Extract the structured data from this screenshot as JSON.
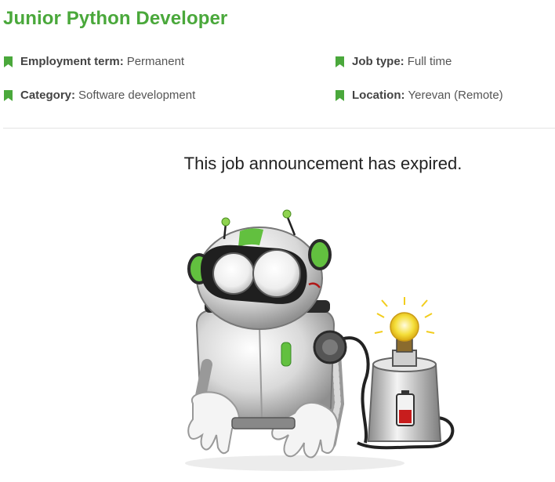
{
  "job": {
    "title": "Junior Python Developer"
  },
  "details": [
    {
      "label": "Employment term:",
      "value": "Permanent"
    },
    {
      "label": "Job type:",
      "value": "Full time"
    },
    {
      "label": "Category:",
      "value": "Software development"
    },
    {
      "label": "Location:",
      "value": "Yerevan (Remote)"
    }
  ],
  "notice": {
    "text": "This job announcement has expired."
  },
  "colors": {
    "accent": "#4aa83b",
    "bookmark": "#4aa83b",
    "divider": "#e3e3e3"
  },
  "icons": {
    "detail_marker": "bookmark-icon",
    "illustration": "robot-illustration"
  }
}
